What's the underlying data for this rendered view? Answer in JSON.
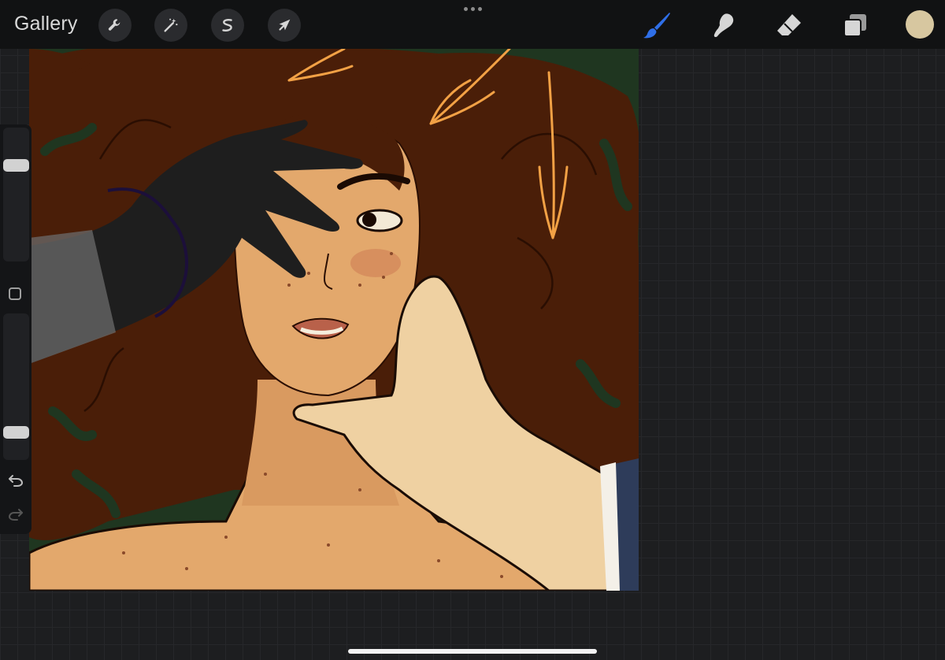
{
  "toolbar": {
    "gallery_label": "Gallery",
    "left_tools": [
      {
        "name": "actions",
        "icon": "wrench-icon"
      },
      {
        "name": "adjustments",
        "icon": "magic-wand-icon"
      },
      {
        "name": "selection",
        "icon": "selection-s-icon"
      },
      {
        "name": "transform",
        "icon": "arrow-cursor-icon"
      }
    ],
    "right_tools": [
      {
        "name": "brush",
        "icon": "brush-icon",
        "active": true
      },
      {
        "name": "smudge",
        "icon": "smudge-finger-icon",
        "active": false
      },
      {
        "name": "eraser",
        "icon": "eraser-icon",
        "active": false
      },
      {
        "name": "layers",
        "icon": "layers-icon",
        "active": false
      }
    ],
    "current_color": "#d7c7a0",
    "active_tool_color": "#2f6fe8"
  },
  "sidebar": {
    "brush_size_level": 0.26,
    "opacity_level": 0.84,
    "undo_icon": "undo-arrow-icon",
    "redo_icon": "redo-arrow-icon",
    "modify_icon": "square-modify-icon"
  },
  "canvas": {
    "palette": {
      "background_green": "#1f3620",
      "hair": "#4a1e08",
      "skin": "#e3a86c",
      "skin_shadow": "#cf8e58",
      "right_hand": "#efd1a2",
      "dark_hand": "#1e1e1e",
      "sketch_orange": "#f2a145",
      "sleeve": "#2e3c5a"
    }
  }
}
